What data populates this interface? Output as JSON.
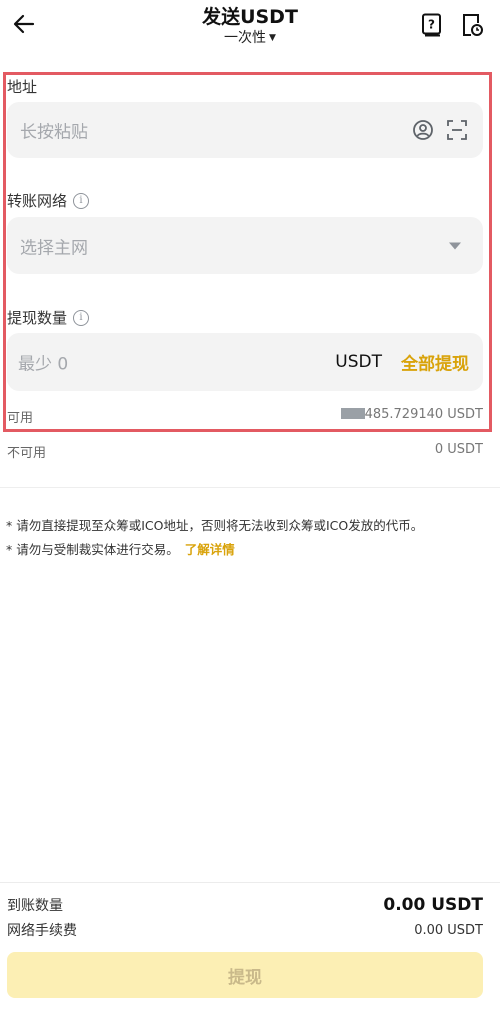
{
  "header": {
    "title": "发送USDT",
    "subtitle": "一次性",
    "icons": {
      "back": "arrow-left-icon",
      "help": "question-book-icon",
      "history": "document-clock-icon"
    }
  },
  "address": {
    "label": "地址",
    "placeholder": "长按粘贴",
    "icons": {
      "contact": "user-circle-icon",
      "scan": "scan-icon"
    }
  },
  "network": {
    "label": "转账网络",
    "placeholder": "选择主网"
  },
  "amount": {
    "label": "提现数量",
    "placeholder": "最少 0",
    "unit": "USDT",
    "max_label": "全部提现"
  },
  "balances": {
    "available_label": "可用",
    "available_value": "485.729140 USDT",
    "unavailable_label": "不可用",
    "unavailable_value": "0 USDT"
  },
  "notes": {
    "line1": "* 请勿直接提现至众筹或ICO地址，否则将无法收到众筹或ICO发放的代币。",
    "line2": "* 请勿与受制裁实体进行交易。",
    "learn_more": "了解详情"
  },
  "summary": {
    "received_label": "到账数量",
    "received_value": "0.00 USDT",
    "fee_label": "网络手续费",
    "fee_value": "0.00 USDT"
  },
  "submit_label": "提现",
  "colors": {
    "accent": "#d9a30b",
    "highlight_border": "#e35a62",
    "button_disabled": "#fcefb4"
  }
}
